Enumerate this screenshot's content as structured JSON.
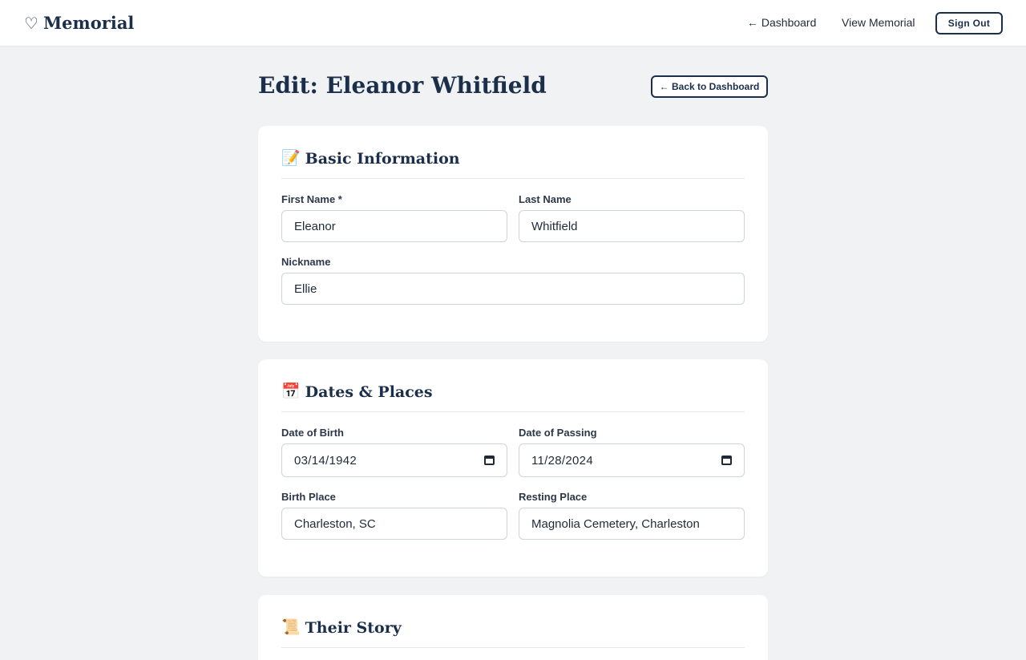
{
  "header": {
    "brand_icon": "♡",
    "brand_name": "Memorial",
    "nav_dashboard": "← Dashboard",
    "nav_view_memorial": "View Memorial",
    "sign_out": "Sign Out"
  },
  "page": {
    "title": "Edit: Eleanor Whitfield",
    "back_button": "← Back to Dashboard"
  },
  "basic_info": {
    "emoji": "📝",
    "title": "Basic Information",
    "first_name_label": "First Name *",
    "first_name_value": "Eleanor",
    "last_name_label": "Last Name",
    "last_name_value": "Whitfield",
    "nickname_label": "Nickname",
    "nickname_value": "Ellie"
  },
  "dates_places": {
    "emoji": "📅",
    "title": "Dates & Places",
    "dob_label": "Date of Birth",
    "dob_value": "03/14/1942",
    "dop_label": "Date of Passing",
    "dop_value": "11/28/2024",
    "birth_place_label": "Birth Place",
    "birth_place_value": "Charleston, SC",
    "resting_place_label": "Resting Place",
    "resting_place_value": "Magnolia Cemetery, Charleston"
  },
  "story": {
    "emoji": "📜",
    "title": "Their Story"
  },
  "colors": {
    "brand_navy": "#1b2f4a",
    "background": "#f1f2f4",
    "card": "#ffffff",
    "input_border": "#cfd4da"
  }
}
